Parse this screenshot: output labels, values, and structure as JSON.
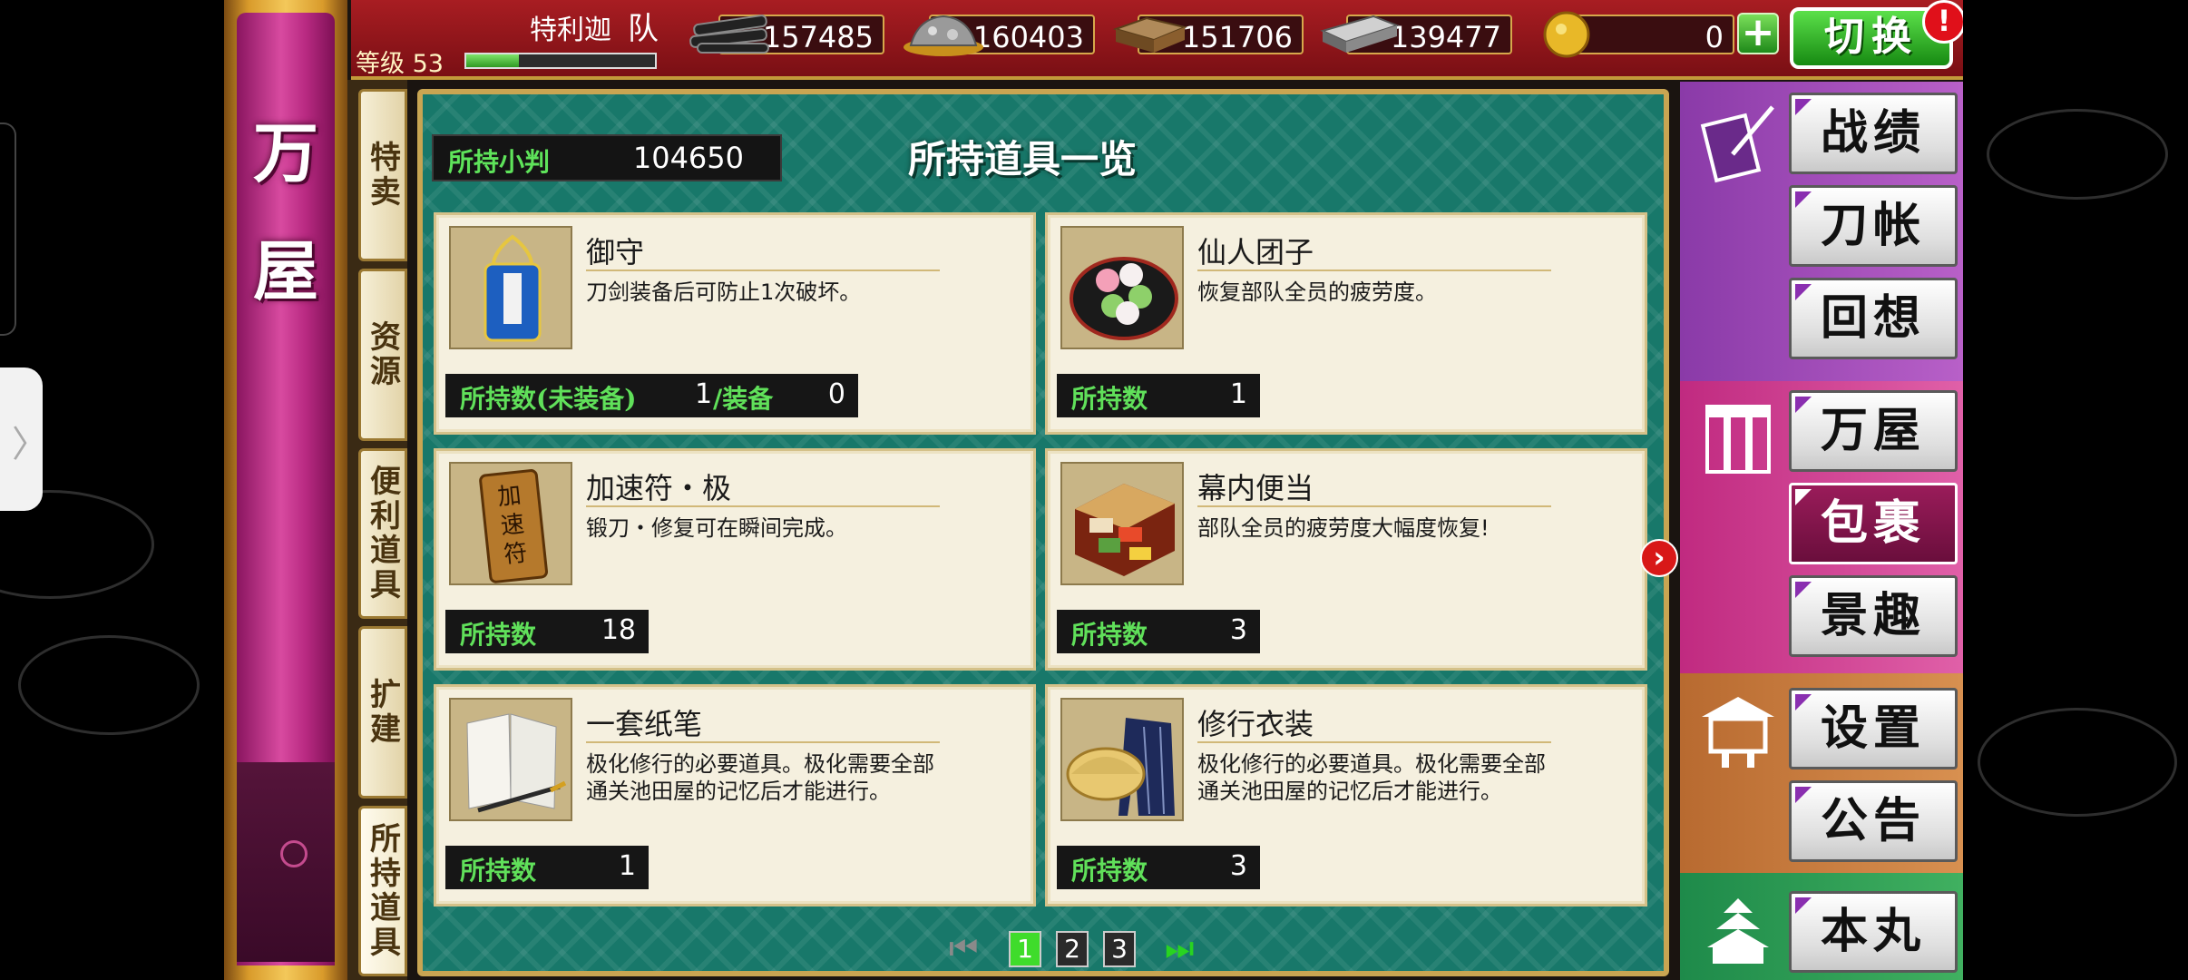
{
  "topbar": {
    "level_label": "等级 53",
    "level_progress": 0.28,
    "player_name": "特利迦",
    "team_suffix": "队",
    "resources": [
      {
        "icon": "charcoal-icon",
        "value": "157485"
      },
      {
        "icon": "tamahagane-icon",
        "value": "160403"
      },
      {
        "icon": "cooling-material-icon",
        "value": "151706"
      },
      {
        "icon": "whetstone-icon",
        "value": "139477"
      },
      {
        "icon": "gold-coin-icon",
        "value": "0"
      }
    ],
    "plus_label": "+",
    "switch_label": "切换",
    "alert_label": "!"
  },
  "pillar": {
    "title_1": "万",
    "title_2": "屋"
  },
  "left_tabs": [
    {
      "label": "特卖",
      "active": false
    },
    {
      "label": "资源",
      "active": false
    },
    {
      "label": "便利道具",
      "active": false
    },
    {
      "label": "扩建",
      "active": false
    },
    {
      "label": "所持道具",
      "active": true
    }
  ],
  "panel": {
    "title": "所持道具一览",
    "money_label": "所持小判",
    "money_value": "104650"
  },
  "items": [
    {
      "name": "御守",
      "desc": "刀剑装备后可防止1次破坏。",
      "count_label": "所持数(未装备)",
      "count_value": "1",
      "equip_label": "/装备",
      "equip_value": "0",
      "thumb": "omamori-icon"
    },
    {
      "name": "仙人团子",
      "desc": "恢复部队全员的疲劳度。",
      "count_label": "所持数",
      "count_value": "1",
      "thumb": "dango-icon"
    },
    {
      "name": "加速符・极",
      "desc": "锻刀・修复可在瞬间完成。",
      "count_label": "所持数",
      "count_value": "18",
      "thumb": "talisman-icon"
    },
    {
      "name": "幕内便当",
      "desc": "部队全员的疲劳度大幅度恢复!",
      "count_label": "所持数",
      "count_value": "3",
      "thumb": "bento-icon"
    },
    {
      "name": "一套纸笔",
      "desc_1": "极化修行的必要道具。极化需要全部",
      "desc_2": "通关池田屋的记忆后才能进行。",
      "count_label": "所持数",
      "count_value": "1",
      "thumb": "paper-brush-icon"
    },
    {
      "name": "修行衣装",
      "desc_1": "极化修行的必要道具。极化需要全部",
      "desc_2": "通关池田屋的记忆后才能进行。",
      "count_label": "所持数",
      "count_value": "3",
      "thumb": "training-outfit-icon"
    }
  ],
  "pagination": {
    "pages": [
      "1",
      "2",
      "3"
    ],
    "current": "1"
  },
  "right_menu": {
    "records": "战绩",
    "sword_book": "刀帐",
    "recollection": "回想",
    "shop": "万屋",
    "inventory": "包裹",
    "scenery": "景趣",
    "settings": "设置",
    "notice": "公告",
    "honmaru": "本丸"
  },
  "colors": {
    "accent_green": "#5ee35a",
    "panel_teal": "#18786a",
    "pillar_pink": "#d84aa0",
    "topbar_red": "#a81d22"
  }
}
